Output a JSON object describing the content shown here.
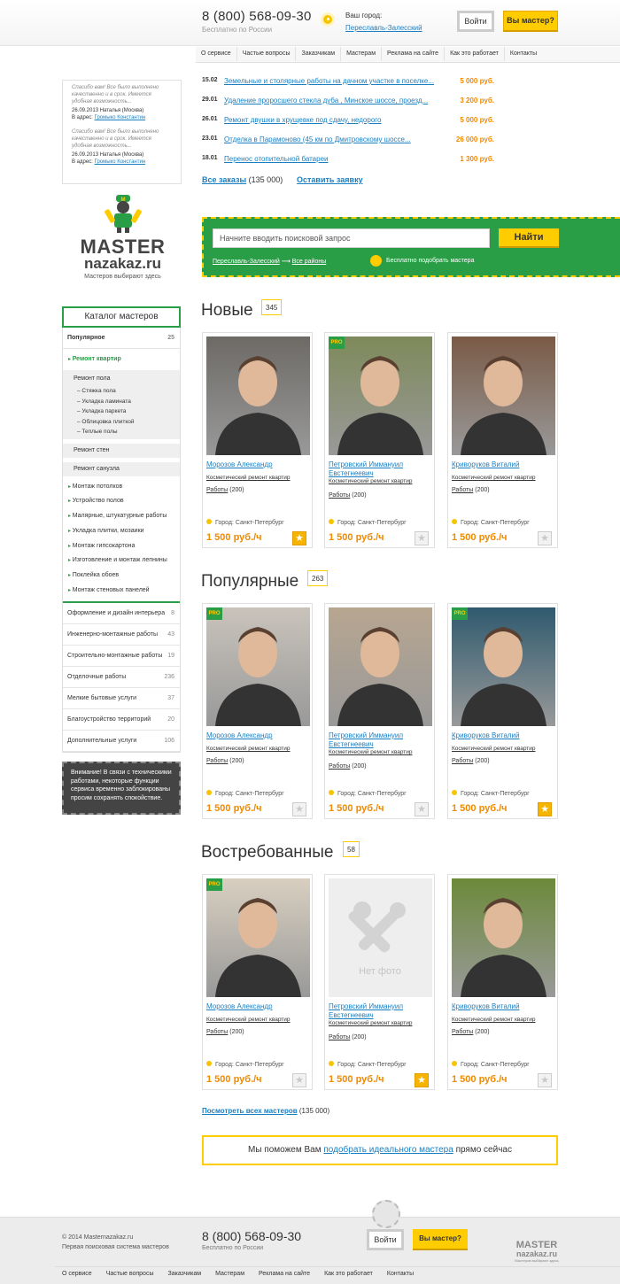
{
  "header": {
    "phone": "8 (800) 568-09-30",
    "phone_sub": "Бесплатно по России",
    "city_label": "Ваш город:",
    "city_value": "Переславль-Залесский",
    "login_label": "Войти",
    "master_label": "Вы мастер?"
  },
  "nav": [
    "О сервисе",
    "Частые вопросы",
    "Заказчикам",
    "Мастерам",
    "Реклама на сайте",
    "Как это работает",
    "Контакты"
  ],
  "reviews": [
    {
      "text": "Спасибо вам! Все было выполнено качественно и в срок. Имеется удобная возможность...",
      "date": "26.09.2013",
      "author": "Наталья (Москва)",
      "addr_label": "В адрес:",
      "addr": "Громыко Константин"
    },
    {
      "text": "Спасибо вам! Все было выполнено качественно и в срок. Имеется удобная возможность...",
      "date": "26.09.2013",
      "author": "Наталья (Москва)",
      "addr_label": "В адрес:",
      "addr": "Громыко Константин"
    }
  ],
  "orders": [
    {
      "date": "15.02",
      "title": "Земельные и столярные работы на дачном участке в поселке...",
      "price": "5 000 руб."
    },
    {
      "date": "29.01",
      "title": "Удаление проросшего стекла дуба , Минское шоссе, проезд...",
      "price": "3 200 руб."
    },
    {
      "date": "26.01",
      "title": "Ремонт двушки в хрущевке под сдачу, недорого",
      "price": "5 000 руб."
    },
    {
      "date": "23.01",
      "title": "Отделка в Парамоново (45 км по Дмитровскому шоссе...",
      "price": "26 000 руб."
    },
    {
      "date": "18.01",
      "title": "Перенос отопительной батареи",
      "price": "1 300 руб."
    }
  ],
  "orders_footer": {
    "all": "Все заказы",
    "count": "(135 000)",
    "new": "Оставить заявку"
  },
  "logo": {
    "w1": "MASTER",
    "w2": "nazakaz.ru",
    "tag": "Мастеров выбирают здесь"
  },
  "search": {
    "placeholder": "Начните вводить поисковой запрос",
    "button": "Найти",
    "city": "Переславль-Залесский",
    "arrow": "⟶",
    "regions": "Все районы",
    "free": "Бесплатно подобрать мастера"
  },
  "catalog": {
    "title": "Каталог мастеров",
    "popular": "Популярное",
    "popular_n": "25",
    "repair": "Ремонт квартир",
    "floor": "Ремонт пола",
    "floor_items": [
      "Стяжка пола",
      "Укладка ламината",
      "Укладка паркета",
      "Облицовка плиткой",
      "Теплые полы"
    ],
    "walls": "Ремонт стен",
    "bath": "Ремонт санузла",
    "items": [
      "Монтаж потолков",
      "Устройство полов",
      "Малярные, штукатурные работы",
      "Укладка плитки, мозаики",
      "Монтаж гипсокартона",
      "Изготовление и монтаж лепнины",
      "Поклейка обоев",
      "Монтаж стеновых панелей"
    ],
    "groups": [
      {
        "label": "Оформление и дизайн интерьера",
        "n": "8"
      },
      {
        "label": "Инженерно-монтажные работы",
        "n": "43"
      },
      {
        "label": "Строительно-монтажные работы",
        "n": "19"
      },
      {
        "label": "Отделочные работы",
        "n": "236"
      },
      {
        "label": "Мелкие бытовые услуги",
        "n": "37"
      },
      {
        "label": "Благоустройство территорий",
        "n": "20"
      },
      {
        "label": "Дополнительные услуги",
        "n": "106"
      }
    ]
  },
  "notice": "Внимание! В связи с техническими работами, некоторые функции сервиса временно заблокированы просим сохранять спокойствие.",
  "sections": [
    {
      "title": "Новые",
      "count": "345",
      "cards": [
        {
          "pro": false,
          "name": "Морозов Александр",
          "spec": "Косметический ремонт квартир",
          "jobs_label": "Работы",
          "jobs": "(200)",
          "city": "Город: Санкт-Петербург",
          "price": "1 500 руб./ч",
          "fav": true
        },
        {
          "pro": true,
          "name": "Петровский Иммануил Евстегнеевич",
          "spec": "Косметический ремонт квартир",
          "jobs_label": "Работы",
          "jobs": "(200)",
          "city": "Город: Санкт-Петербург",
          "price": "1 500 руб./ч",
          "fav": false
        },
        {
          "pro": false,
          "name": "Криворуков Виталий",
          "spec": "Косметический ремонт квартир",
          "jobs_label": "Работы",
          "jobs": "(200)",
          "city": "Город: Санкт-Петербург",
          "price": "1 500 руб./ч",
          "fav": false
        }
      ]
    },
    {
      "title": "Популярные",
      "count": "263",
      "cards": [
        {
          "pro": true,
          "name": "Морозов Александр",
          "spec": "Косметический ремонт квартир",
          "jobs_label": "Работы",
          "jobs": "(200)",
          "city": "Город: Санкт-Петербург",
          "price": "1 500 руб./ч",
          "fav": false
        },
        {
          "pro": false,
          "name": "Петровский Иммануил Евстегнеевич",
          "spec": "Косметический ремонт квартир",
          "jobs_label": "Работы",
          "jobs": "(200)",
          "city": "Город: Санкт-Петербург",
          "price": "1 500 руб./ч",
          "fav": false
        },
        {
          "pro": true,
          "name": "Криворуков Виталий",
          "spec": "Косметический ремонт квартир",
          "jobs_label": "Работы",
          "jobs": "(200)",
          "city": "Город: Санкт-Петербург",
          "price": "1 500 руб./ч",
          "fav": true
        }
      ]
    },
    {
      "title": "Востребованные",
      "count": "58",
      "cards": [
        {
          "pro": true,
          "name": "Морозов Александр",
          "spec": "Косметический ремонт квартир",
          "jobs_label": "Работы",
          "jobs": "(200)",
          "city": "Город: Санкт-Петербург",
          "price": "1 500 руб./ч",
          "fav": false
        },
        {
          "pro": false,
          "name": "Петровский Иммануил Евстегнеевич",
          "spec": "Косметический ремонт квартир",
          "jobs_label": "Работы",
          "jobs": "(200)",
          "city": "Город: Санкт-Петербург",
          "price": "1 500 руб./ч",
          "fav": true,
          "nophoto": "Нет фото"
        },
        {
          "pro": false,
          "name": "Криворуков Виталий",
          "spec": "Косметический ремонт квартир",
          "jobs_label": "Работы",
          "jobs": "(200)",
          "city": "Город: Санкт-Петербург",
          "price": "1 500 руб./ч",
          "fav": false
        }
      ]
    }
  ],
  "pro_label": "PRO",
  "see_all": {
    "link": "Посмотреть всех мастеров",
    "count": "(135 000)"
  },
  "help": {
    "pre": "Мы поможем Вам",
    "link": "подобрать идеального мастера",
    "post": "прямо сейчас"
  },
  "footer": {
    "copy1": "© 2014 Masternazakaz.ru",
    "copy2": "Первая поисковая система мастеров",
    "phone": "8 (800) 568-09-30",
    "phone_sub": "Бесплатно по России",
    "login": "Войти",
    "master": "Вы мастер?",
    "logo1": "MASTER",
    "logo2": "nazakaz.ru",
    "logo3": "Мастеров выбирают здесь"
  },
  "colors": {
    "green": "#2a9d47",
    "yellow": "#ffcc00",
    "orange": "#f08a00",
    "link": "#1a7fc1"
  }
}
